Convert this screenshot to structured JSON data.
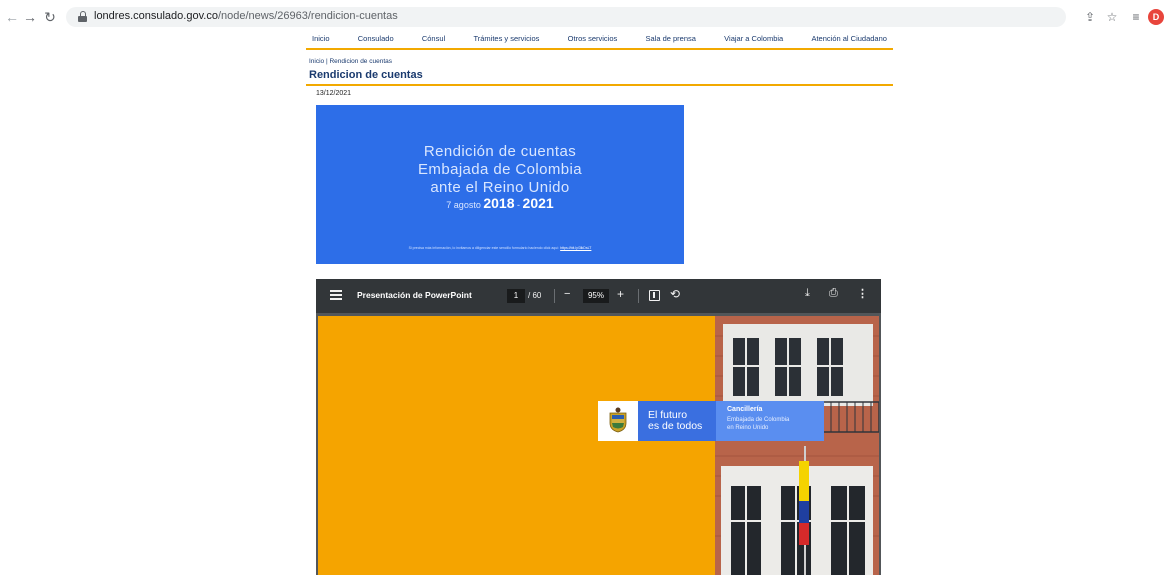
{
  "browser": {
    "url_host": "londres.consulado.gov.co",
    "url_path": "/node/news/26963/rendicion-cuentas",
    "profile_initial": "D"
  },
  "site_nav": {
    "items": [
      "Inicio",
      "Consulado",
      "Cónsul",
      "Trámites y servicios",
      "Otros servicios",
      "Sala de prensa",
      "Viajar a Colombia",
      "Atención al Ciudadano"
    ]
  },
  "breadcrumb": "Inicio | Rendicion de cuentas",
  "page_title": "Rendicion de cuentas",
  "post_date": "13/12/2021",
  "banner": {
    "line1": "Rendición de cuentas",
    "line2": "Embajada de Colombia",
    "line3": "ante el Reino Unido",
    "period_prefix": "7 agosto",
    "year_start": "2018",
    "year_sep": "-",
    "year_end": "2021",
    "note": "Si precisa más información, lo invitamos a diligenciar este sencillo formulario haciendo click aquí:",
    "note_link": "https://bit.ly/3lkDsLT",
    "color": "#2d6ee8"
  },
  "pdf_viewer": {
    "title": "Presentación de PowerPoint",
    "current_page": "1",
    "total_pages": "/ 60",
    "zoom": "95%",
    "slide": {
      "background_color": "#f5a400",
      "motto_line1": "El futuro",
      "motto_line2": "es de todos",
      "org_title": "Cancillería",
      "org_line1": "Embajada de Colombia",
      "org_line2": "en Reino Unido"
    }
  },
  "colors": {
    "accent_rule": "#f2a900",
    "nav_text": "#1a3a6e"
  },
  "icons": {
    "back": "arrow-left",
    "forward": "arrow-right",
    "reload": "reload",
    "lock": "lock",
    "share": "share",
    "star": "star",
    "reading_list": "reading-list",
    "menu": "hamburger",
    "fit": "fit-page",
    "rotate": "rotate",
    "download": "download",
    "print": "print",
    "more": "more-vertical"
  }
}
